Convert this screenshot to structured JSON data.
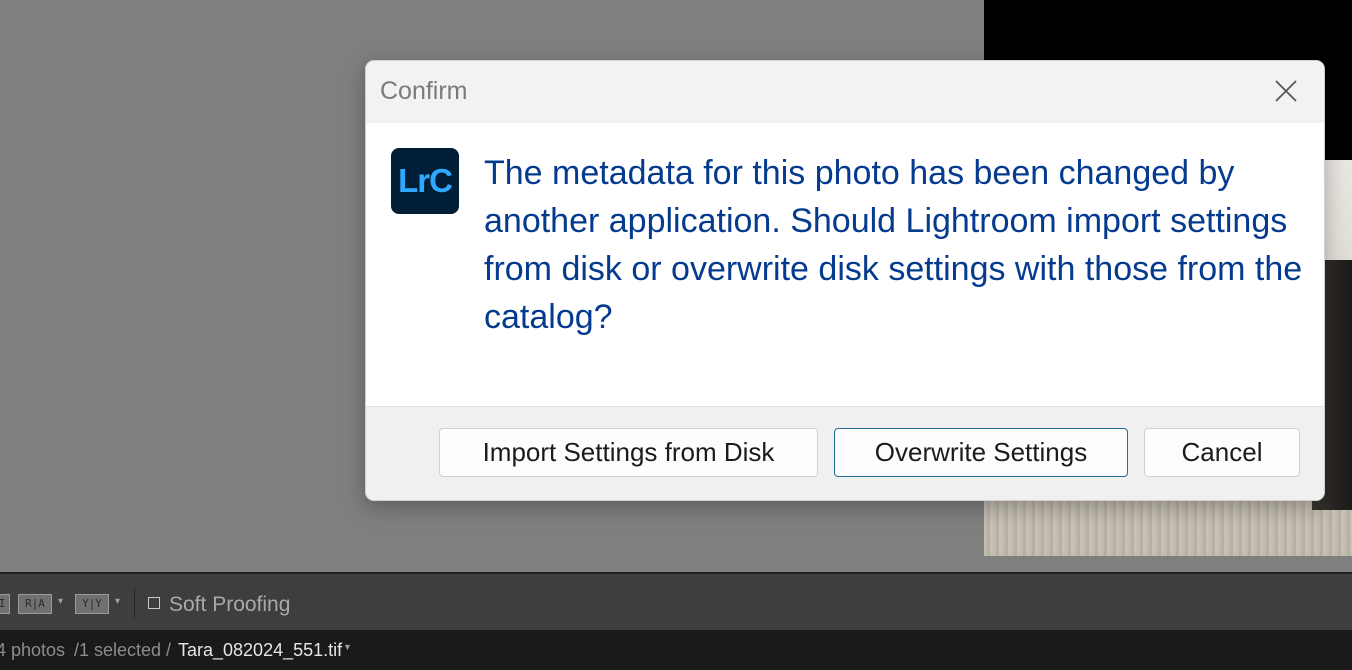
{
  "dialog": {
    "title": "Confirm",
    "app_icon_text": "LrC",
    "message": "The metadata for this photo has been changed by another application. Should Lightroom import settings from disk or overwrite disk settings with those from the catalog?",
    "buttons": {
      "import": "Import Settings from Disk",
      "overwrite": "Overwrite Settings",
      "cancel": "Cancel"
    }
  },
  "toolbar": {
    "view_buttons": [
      "I",
      "R|A",
      "Y|Y"
    ],
    "soft_proofing_label": "Soft Proofing",
    "soft_proofing_checked": false
  },
  "filmstrip": {
    "photos_count": "4 photos",
    "selected": "/1 selected /",
    "filename": "Tara_082024_551.tif"
  },
  "colors": {
    "dialog_message": "#053b8f",
    "lrc_icon_bg": "#001e36",
    "lrc_icon_text": "#31a8ff",
    "workspace_bg": "#7f7f7f"
  }
}
